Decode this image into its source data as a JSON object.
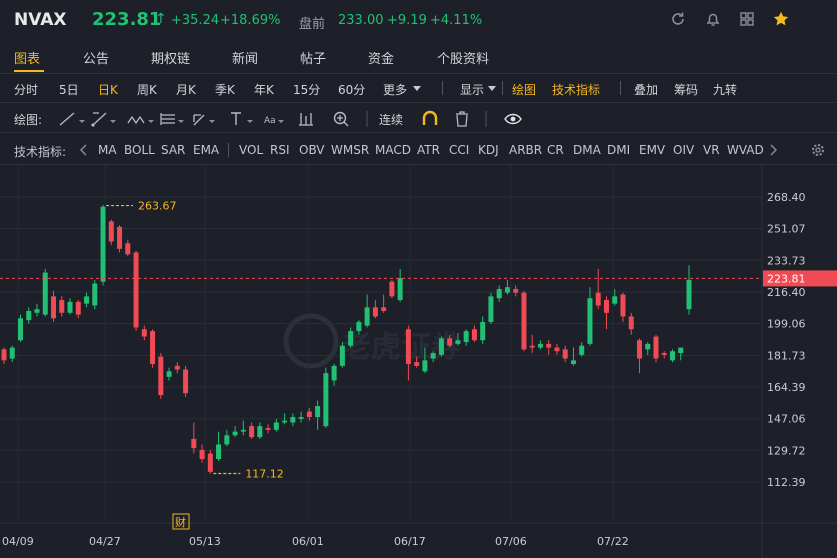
{
  "header": {
    "ticker": "NVAX",
    "price": "223.81",
    "arrow": "↑",
    "change": "+35.24",
    "change_pct": "+18.69%",
    "premarket_label": "盘前",
    "premarket_price": "233.00",
    "premarket_change": "+9.19",
    "premarket_pct": "+4.11%",
    "icons": [
      "refresh-icon",
      "bell-icon",
      "grid-icon",
      "star-icon"
    ],
    "colors": {
      "up": "#21c074",
      "down": "#f04b54",
      "accent": "#f5b81e"
    }
  },
  "tabs": [
    {
      "label": "图表",
      "active": true
    },
    {
      "label": "公告"
    },
    {
      "label": "期权链"
    },
    {
      "label": "新闻"
    },
    {
      "label": "帖子"
    },
    {
      "label": "资金"
    },
    {
      "label": "个股资料"
    }
  ],
  "periods": [
    "分时",
    "5日",
    "日K",
    "周K",
    "月K",
    "季K",
    "年K",
    "15分",
    "60分",
    "更多"
  ],
  "period_active": "日K",
  "period_extras": {
    "display": "显示",
    "draw": "绘图",
    "indicators": "技术指标",
    "overlay": "叠加",
    "chips": "筹码",
    "nine": "九转"
  },
  "drawbar": {
    "label": "绘图:",
    "continuous": "连续"
  },
  "indicators_bar": {
    "label": "技术指标:",
    "items": [
      "MA",
      "BOLL",
      "SAR",
      "EMA",
      "VOL",
      "RSI",
      "OBV",
      "WMSR",
      "MACD",
      "ATR",
      "CCI",
      "KDJ",
      "ARBR",
      "CR",
      "DMA",
      "DMI",
      "EMV",
      "OIV",
      "VR",
      "WVAD"
    ]
  },
  "chart_data": {
    "type": "candlestick",
    "y_ticks": [
      "268.40",
      "251.07",
      "233.73",
      "216.40",
      "199.06",
      "181.73",
      "164.39",
      "147.06",
      "129.72",
      "112.39"
    ],
    "ylim": [
      103.7,
      277.1
    ],
    "x_ticks": [
      "04/09",
      "04/27",
      "05/13",
      "06/01",
      "06/17",
      "07/06",
      "07/22"
    ],
    "current_price_label": "223.81",
    "current_price": 223.81,
    "high_marker": {
      "label": "263.67",
      "value": 263.67
    },
    "low_marker": {
      "label": "117.12",
      "value": 117.12
    },
    "earnings_marker": "财",
    "watermark": "老虎证券",
    "candles": [
      {
        "o": 185,
        "c": 179,
        "h": 186,
        "l": 177
      },
      {
        "o": 180,
        "c": 186,
        "h": 187,
        "l": 178
      },
      {
        "o": 190,
        "c": 202,
        "h": 204,
        "l": 189
      },
      {
        "o": 201,
        "c": 206,
        "h": 208,
        "l": 199
      },
      {
        "o": 205,
        "c": 207,
        "h": 210,
        "l": 203
      },
      {
        "o": 204,
        "c": 227,
        "h": 229,
        "l": 203
      },
      {
        "o": 214,
        "c": 202,
        "h": 217,
        "l": 200
      },
      {
        "o": 212,
        "c": 205,
        "h": 214,
        "l": 203
      },
      {
        "o": 205,
        "c": 211,
        "h": 213,
        "l": 204
      },
      {
        "o": 211,
        "c": 204,
        "h": 212,
        "l": 202
      },
      {
        "o": 210,
        "c": 214,
        "h": 216,
        "l": 208
      },
      {
        "o": 209,
        "c": 221,
        "h": 223,
        "l": 207
      },
      {
        "o": 222,
        "c": 263,
        "h": 264,
        "l": 220
      },
      {
        "o": 255,
        "c": 244,
        "h": 256,
        "l": 242
      },
      {
        "o": 252,
        "c": 240,
        "h": 253,
        "l": 238
      },
      {
        "o": 243,
        "c": 237,
        "h": 245,
        "l": 236
      },
      {
        "o": 238,
        "c": 197,
        "h": 239,
        "l": 195
      },
      {
        "o": 196,
        "c": 192,
        "h": 198,
        "l": 190
      },
      {
        "o": 195,
        "c": 177,
        "h": 196,
        "l": 175
      },
      {
        "o": 181,
        "c": 160,
        "h": 183,
        "l": 158
      },
      {
        "o": 170,
        "c": 173,
        "h": 175,
        "l": 168
      },
      {
        "o": 176,
        "c": 174,
        "h": 178,
        "l": 172
      },
      {
        "o": 174,
        "c": 161,
        "h": 176,
        "l": 159
      },
      {
        "o": 136,
        "c": 131,
        "h": 145,
        "l": 128
      },
      {
        "o": 130,
        "c": 125,
        "h": 133,
        "l": 123
      },
      {
        "o": 128,
        "c": 118,
        "h": 130,
        "l": 117
      },
      {
        "o": 125,
        "c": 133,
        "h": 140,
        "l": 124
      },
      {
        "o": 133,
        "c": 138,
        "h": 141,
        "l": 132
      },
      {
        "o": 138,
        "c": 140,
        "h": 143,
        "l": 137
      },
      {
        "o": 140,
        "c": 141,
        "h": 146,
        "l": 138
      },
      {
        "o": 143,
        "c": 137,
        "h": 145,
        "l": 136
      },
      {
        "o": 137,
        "c": 143,
        "h": 145,
        "l": 136
      },
      {
        "o": 142,
        "c": 141,
        "h": 144,
        "l": 139
      },
      {
        "o": 141,
        "c": 145,
        "h": 147,
        "l": 140
      },
      {
        "o": 145,
        "c": 146,
        "h": 150,
        "l": 144
      },
      {
        "o": 145,
        "c": 148,
        "h": 150,
        "l": 143
      },
      {
        "o": 147,
        "c": 148,
        "h": 151,
        "l": 145
      },
      {
        "o": 151,
        "c": 148,
        "h": 153,
        "l": 146
      },
      {
        "o": 148,
        "c": 154,
        "h": 157,
        "l": 141
      },
      {
        "o": 143,
        "c": 172,
        "h": 175,
        "l": 142
      },
      {
        "o": 168,
        "c": 176,
        "h": 177,
        "l": 165
      },
      {
        "o": 176,
        "c": 187,
        "h": 189,
        "l": 175
      },
      {
        "o": 187,
        "c": 195,
        "h": 197,
        "l": 186
      },
      {
        "o": 195,
        "c": 200,
        "h": 201,
        "l": 193
      },
      {
        "o": 198,
        "c": 208,
        "h": 215,
        "l": 197
      },
      {
        "o": 208,
        "c": 203,
        "h": 212,
        "l": 202
      },
      {
        "o": 208,
        "c": 206,
        "h": 215,
        "l": 205
      },
      {
        "o": 222,
        "c": 214,
        "h": 223,
        "l": 213
      },
      {
        "o": 212,
        "c": 224,
        "h": 229,
        "l": 211
      },
      {
        "o": 196,
        "c": 177,
        "h": 198,
        "l": 168
      },
      {
        "o": 178,
        "c": 176,
        "h": 181,
        "l": 175
      },
      {
        "o": 173,
        "c": 179,
        "h": 186,
        "l": 172
      },
      {
        "o": 180,
        "c": 183,
        "h": 184,
        "l": 178
      },
      {
        "o": 182,
        "c": 191,
        "h": 192,
        "l": 181
      },
      {
        "o": 191,
        "c": 187,
        "h": 193,
        "l": 186
      },
      {
        "o": 188,
        "c": 190,
        "h": 194,
        "l": 187
      },
      {
        "o": 189,
        "c": 195,
        "h": 196,
        "l": 187
      },
      {
        "o": 196,
        "c": 190,
        "h": 198,
        "l": 189
      },
      {
        "o": 190,
        "c": 200,
        "h": 203,
        "l": 188
      },
      {
        "o": 200,
        "c": 214,
        "h": 216,
        "l": 199
      },
      {
        "o": 213,
        "c": 218,
        "h": 220,
        "l": 211
      },
      {
        "o": 216,
        "c": 219,
        "h": 223,
        "l": 215
      },
      {
        "o": 218,
        "c": 216,
        "h": 220,
        "l": 214
      },
      {
        "o": 216,
        "c": 185,
        "h": 217,
        "l": 184
      },
      {
        "o": 187,
        "c": 186,
        "h": 193,
        "l": 183
      },
      {
        "o": 186,
        "c": 188,
        "h": 190,
        "l": 185
      },
      {
        "o": 188,
        "c": 186,
        "h": 190,
        "l": 182
      },
      {
        "o": 186,
        "c": 184,
        "h": 188,
        "l": 182
      },
      {
        "o": 185,
        "c": 180,
        "h": 187,
        "l": 178
      },
      {
        "o": 177,
        "c": 179,
        "h": 186,
        "l": 176
      },
      {
        "o": 182,
        "c": 187,
        "h": 189,
        "l": 181
      },
      {
        "o": 188,
        "c": 213,
        "h": 219,
        "l": 187
      },
      {
        "o": 216,
        "c": 209,
        "h": 229,
        "l": 207
      },
      {
        "o": 212,
        "c": 205,
        "h": 214,
        "l": 196
      },
      {
        "o": 210,
        "c": 214,
        "h": 218,
        "l": 209
      },
      {
        "o": 215,
        "c": 203,
        "h": 216,
        "l": 200
      },
      {
        "o": 203,
        "c": 196,
        "h": 205,
        "l": 193
      },
      {
        "o": 190,
        "c": 180,
        "h": 191,
        "l": 172
      },
      {
        "o": 185,
        "c": 188,
        "h": 189,
        "l": 182
      },
      {
        "o": 192,
        "c": 180,
        "h": 193,
        "l": 178
      },
      {
        "o": 183,
        "c": 182,
        "h": 184,
        "l": 180
      },
      {
        "o": 179,
        "c": 184,
        "h": 185,
        "l": 178
      },
      {
        "o": 183,
        "c": 186,
        "h": 186,
        "l": 179
      },
      {
        "o": 207,
        "c": 223,
        "h": 231,
        "l": 204
      }
    ]
  }
}
